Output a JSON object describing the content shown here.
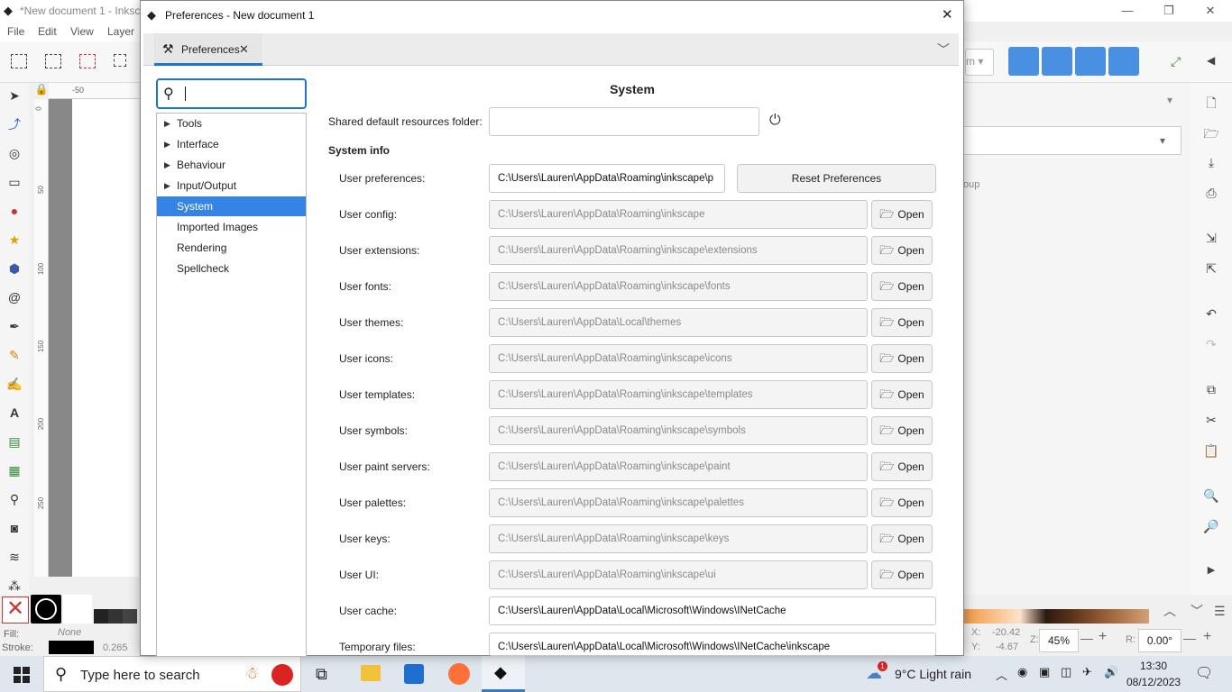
{
  "bg": {
    "title": "*New document 1 - Inksc",
    "menu": [
      "File",
      "Edit",
      "View",
      "Layer"
    ],
    "win_min": "—",
    "win_max": "❐",
    "win_close": "✕",
    "ruler_mark": "-50",
    "ruler_v": [
      "0",
      "50",
      "100",
      "150",
      "200",
      "250"
    ],
    "right_hint1": "m",
    "right_hint2": "oup",
    "status": {
      "fill_label": "Fill:",
      "fill_value": "None",
      "stroke_label": "Stroke:",
      "stroke_width": "0.265",
      "x_label": "X:",
      "x_value": "-20.42",
      "y_label": "Y:",
      "y_value": "-4.67",
      "zoom_label": "Z:",
      "zoom": "45%",
      "rot_label": "R:",
      "rotation": "0.00°",
      "minus": "—",
      "plus": "+"
    }
  },
  "dialog": {
    "title": "Preferences - New document 1",
    "tab": "Preferences",
    "search_placeholder": "",
    "tree": [
      {
        "label": "Tools",
        "expandable": true
      },
      {
        "label": "Interface",
        "expandable": true
      },
      {
        "label": "Behaviour",
        "expandable": true
      },
      {
        "label": "Input/Output",
        "expandable": true
      },
      {
        "label": "System",
        "expandable": false,
        "selected": true
      },
      {
        "label": "Imported Images",
        "expandable": false
      },
      {
        "label": "Rendering",
        "expandable": false
      },
      {
        "label": "Spellcheck",
        "expandable": false
      }
    ],
    "heading": "System",
    "shared_label": "Shared default resources folder:",
    "shared_value": "",
    "system_info": "System info",
    "reset_label": "Reset Preferences",
    "open_label": "Open",
    "rows": [
      {
        "label": "User preferences:",
        "value": "C:\\Users\\Lauren\\AppData\\Roaming\\inkscape\\p"
      },
      {
        "label": "User config:",
        "value": "C:\\Users\\Lauren\\AppData\\Roaming\\inkscape"
      },
      {
        "label": "User extensions:",
        "value": "C:\\Users\\Lauren\\AppData\\Roaming\\inkscape\\extensions"
      },
      {
        "label": "User fonts:",
        "value": "C:\\Users\\Lauren\\AppData\\Roaming\\inkscape\\fonts"
      },
      {
        "label": "User themes:",
        "value": "C:\\Users\\Lauren\\AppData\\Local\\themes"
      },
      {
        "label": "User icons:",
        "value": "C:\\Users\\Lauren\\AppData\\Roaming\\inkscape\\icons"
      },
      {
        "label": "User templates:",
        "value": "C:\\Users\\Lauren\\AppData\\Roaming\\inkscape\\templates"
      },
      {
        "label": "User symbols:",
        "value": "C:\\Users\\Lauren\\AppData\\Roaming\\inkscape\\symbols"
      },
      {
        "label": "User paint servers:",
        "value": "C:\\Users\\Lauren\\AppData\\Roaming\\inkscape\\paint"
      },
      {
        "label": "User palettes:",
        "value": "C:\\Users\\Lauren\\AppData\\Roaming\\inkscape\\palettes"
      },
      {
        "label": "User keys:",
        "value": "C:\\Users\\Lauren\\AppData\\Roaming\\inkscape\\keys"
      },
      {
        "label": "User UI:",
        "value": "C:\\Users\\Lauren\\AppData\\Roaming\\inkscape\\ui"
      },
      {
        "label": "User cache:",
        "value": "C:\\Users\\Lauren\\AppData\\Local\\Microsoft\\Windows\\INetCache"
      },
      {
        "label": "Temporary files:",
        "value": "C:\\Users\\Lauren\\AppData\\Local\\Microsoft\\Windows\\INetCache\\inkscape"
      }
    ]
  },
  "taskbar": {
    "search_placeholder": "Type here to search",
    "weather": "9°C  Light rain",
    "time": "13:30",
    "date": "08/12/2023",
    "weather_badge": "1"
  },
  "colors": {
    "accent": "#1e74d4",
    "selection": "#3584e4"
  }
}
